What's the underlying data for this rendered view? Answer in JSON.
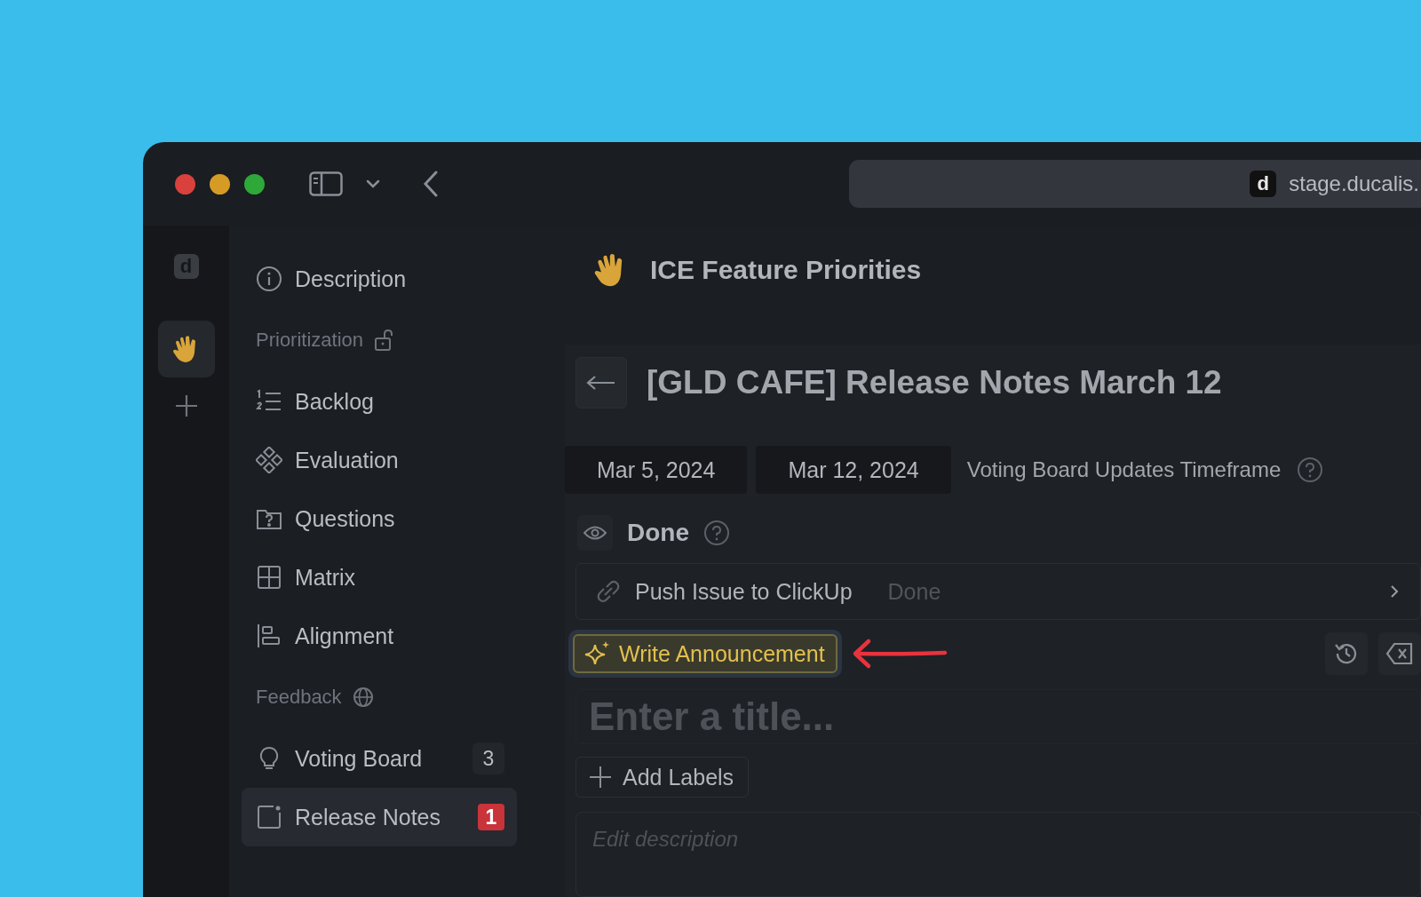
{
  "browser": {
    "site_letter": "d",
    "address": "stage.ducalis."
  },
  "rail": {
    "logo_letter": "d"
  },
  "sidebar": {
    "top_items": [
      {
        "label": "Description",
        "selected": false
      }
    ],
    "sections": [
      {
        "title": "Prioritization",
        "items": [
          {
            "label": "Backlog",
            "selected": false
          },
          {
            "label": "Evaluation",
            "selected": false
          },
          {
            "label": "Questions",
            "selected": false
          },
          {
            "label": "Matrix",
            "selected": false
          },
          {
            "label": "Alignment",
            "selected": false
          }
        ]
      },
      {
        "title": "Feedback",
        "items": [
          {
            "label": "Voting Board",
            "selected": false,
            "badge": {
              "text": "3",
              "highlighted": false
            }
          },
          {
            "label": "Release Notes",
            "selected": true,
            "badge": {
              "text": "1",
              "highlighted": true
            }
          }
        ]
      }
    ]
  },
  "board_title": "ICE Feature Priorities",
  "card": {
    "title": "[GLD CAFE] Release Notes March 12",
    "date_start": "Mar 5, 2024",
    "date_end": "Mar 12, 2024",
    "timeframe_label": "Voting Board Updates Timeframe",
    "status": "Done",
    "integration": {
      "label": "Push Issue to ClickUp",
      "status": "Done"
    },
    "ai_button": "Write Announcement",
    "title_field": {
      "placeholder": "Enter a title..."
    },
    "add_labels": "Add Labels",
    "description_field": {
      "placeholder": "Edit description"
    }
  }
}
